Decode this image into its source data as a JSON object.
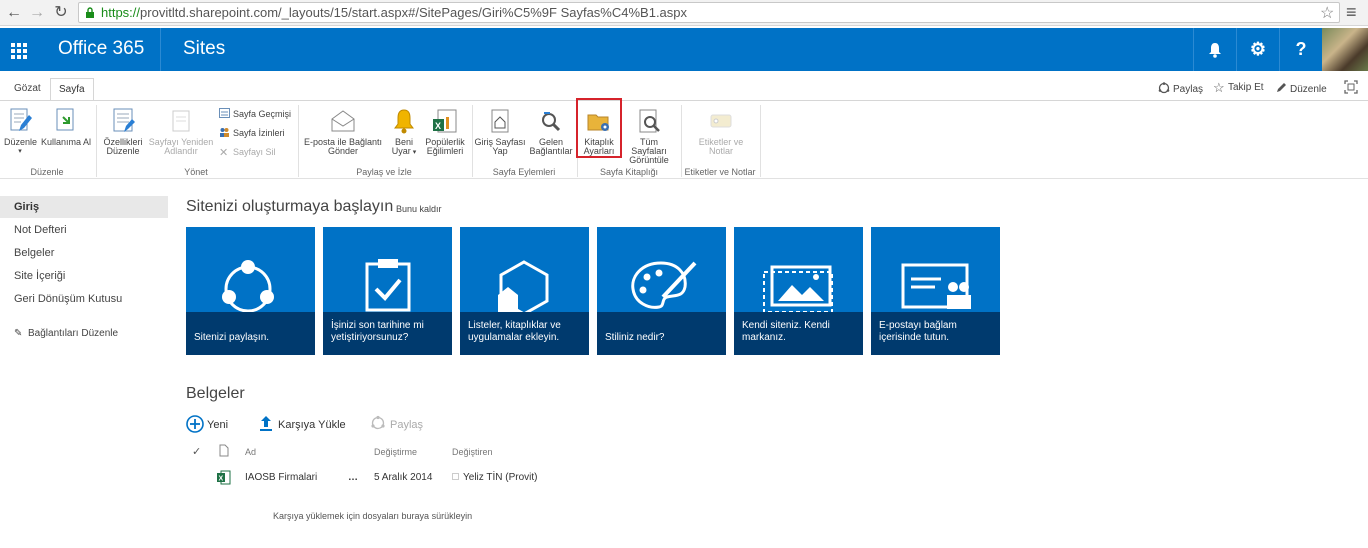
{
  "browser": {
    "url_https": "https://",
    "url_rest": "provitltd.sharepoint.com/_layouts/15/start.aspx#/SitePages/Giri%C5%9F Sayfas%C4%B1.aspx"
  },
  "suite": {
    "brand": "Office 365",
    "nav": "Sites",
    "accent": "#0072c6"
  },
  "ribbon_tabs": [
    "Gözat",
    "Sayfa"
  ],
  "top_actions": {
    "share": "Paylaş",
    "follow": "Takip Et",
    "edit": "Düzenle"
  },
  "ribbon": {
    "edit_group": {
      "label": "Düzenle",
      "edit_btn": "Düzenle",
      "checkout_btn": "Kullanıma Al"
    },
    "manage_group": {
      "label": "Yönet",
      "properties_btn_l1": "Özellikleri",
      "properties_btn_l2": "Düzenle",
      "rename_btn_l1": "Sayfayı Yeniden",
      "rename_btn_l2": "Adlandır",
      "history": "Sayfa Geçmişi",
      "permissions": "Sayfa İzinleri",
      "delete": "Sayfayı Sil"
    },
    "share_group": {
      "label": "Paylaş ve İzle",
      "email_l1": "E-posta ile Bağlantı",
      "email_l2": "Gönder",
      "alert_l1": "Beni",
      "alert_l2": "Uyar",
      "popular_l1": "Popülerlik",
      "popular_l2": "Eğilimleri"
    },
    "actions_group": {
      "label": "Sayfa Eylemleri",
      "homepage_l1": "Giriş Sayfası",
      "homepage_l2": "Yap",
      "incoming_l1": "Gelen",
      "incoming_l2": "Bağlantılar"
    },
    "library_group": {
      "label": "Sayfa Kitaplığı",
      "settings_l1": "Kitaplık",
      "settings_l2": "Ayarları",
      "viewall_l1": "Tüm Sayfaları",
      "viewall_l2": "Görüntüle"
    },
    "tags_group": {
      "label": "Etiketler ve Notlar",
      "tags_l1": "Etiketler ve",
      "tags_l2": "Notlar"
    }
  },
  "leftnav": {
    "items": [
      "Giriş",
      "Not Defteri",
      "Belgeler",
      "Site İçeriği",
      "Geri Dönüşüm Kutusu"
    ],
    "edit_links": "Bağlantıları Düzenle"
  },
  "getting_started": {
    "title": "Sitenizi oluşturmaya başlayın",
    "remove": "Bunu kaldır",
    "tiles": [
      {
        "l1": "Sitenizi paylaşın.",
        "l2": ""
      },
      {
        "l1": "İşinizi son tarihine mi",
        "l2": "yetiştiriyorsunuz?"
      },
      {
        "l1": "Listeler, kitaplıklar ve",
        "l2": "uygulamalar ekleyin."
      },
      {
        "l1": "Stiliniz nedir?",
        "l2": ""
      },
      {
        "l1": "Kendi siteniz. Kendi",
        "l2": "markanız."
      },
      {
        "l1": "E-postayı bağlam",
        "l2": "içerisinde tutun."
      }
    ]
  },
  "documents": {
    "title": "Belgeler",
    "new": "Yeni",
    "upload": "Karşıya Yükle",
    "share": "Paylaş",
    "col_name": "Ad",
    "col_modified": "Değiştirme",
    "col_modified_by": "Değiştiren",
    "rows": [
      {
        "name": "IAOSB Firmalari",
        "modified": "5 Aralık 2014",
        "modified_by": "Yeliz TİN (Provit)"
      }
    ],
    "drop_hint": "Karşıya yüklemek için dosyaları buraya sürükleyin"
  }
}
